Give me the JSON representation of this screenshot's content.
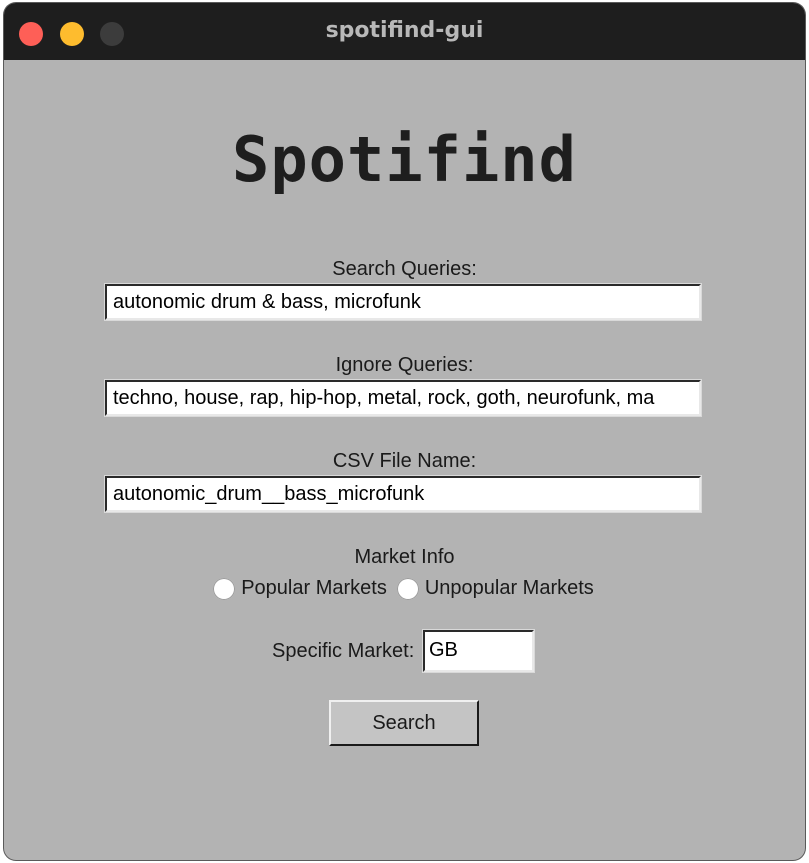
{
  "window": {
    "title": "spotifind-gui"
  },
  "app": {
    "logo_text": "Spotifind"
  },
  "search_queries": {
    "label": "Search Queries:",
    "value": "autonomic drum & bass, microfunk"
  },
  "ignore_queries": {
    "label": "Ignore Queries:",
    "value": "techno, house, rap, hip-hop, metal, rock, goth, neurofunk, ma"
  },
  "csv_file_name": {
    "label": "CSV File Name:",
    "value": "autonomic_drum__bass_microfunk"
  },
  "market_info": {
    "label": "Market Info",
    "options": [
      "Popular Markets",
      "Unpopular Markets"
    ]
  },
  "specific_market": {
    "label": "Specific Market:",
    "value": "GB"
  },
  "search_button": {
    "label": "Search"
  },
  "colors": {
    "background": "#b3b3b3",
    "titlebar": "#1e1e1e",
    "close": "#fe5f57",
    "minimize": "#febc2e"
  }
}
